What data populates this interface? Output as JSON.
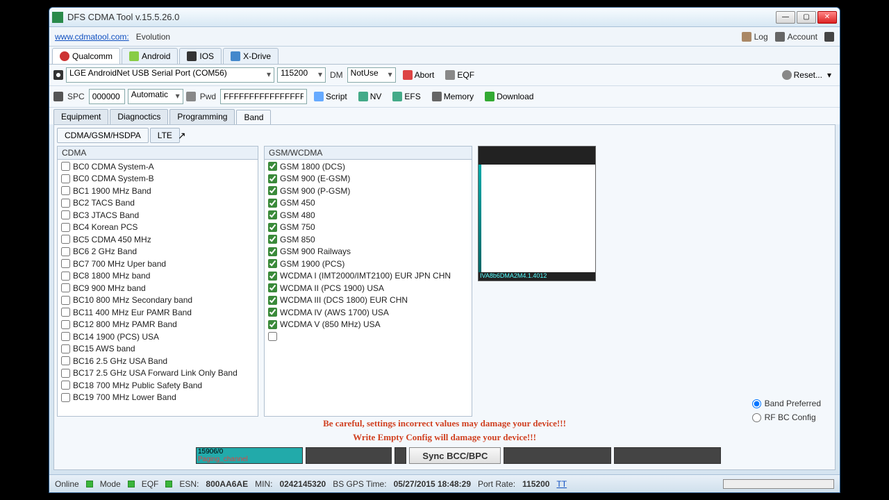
{
  "window": {
    "title": "DFS CDMA Tool v.15.5.26.0"
  },
  "menubar": {
    "link": "www.cdmatool.com:",
    "evolution": "Evolution",
    "log": "Log",
    "account": "Account"
  },
  "platform_tabs": {
    "qualcomm": "Qualcomm",
    "android": "Android",
    "ios": "IOS",
    "xdrive": "X-Drive"
  },
  "toolbar1": {
    "port": "LGE AndroidNet USB Serial Port (COM56)",
    "baud": "115200",
    "dm_label": "DM",
    "dm_value": "NotUse",
    "abort": "Abort",
    "eqf": "EQF",
    "reset": "Reset..."
  },
  "toolbar2": {
    "spc_label": "SPC",
    "spc_value": "000000",
    "spc_mode": "Automatic",
    "pwd_label": "Pwd",
    "pwd_value": "FFFFFFFFFFFFFFFF",
    "script": "Script",
    "nv": "NV",
    "efs": "EFS",
    "memory": "Memory",
    "download": "Download"
  },
  "main_tabs": {
    "equipment": "Equipment",
    "diagnostics": "Diagnoctics",
    "programming": "Programming",
    "band": "Band"
  },
  "sub_tabs": {
    "cdma": "CDMA/GSM/HSDPA",
    "lte": "LTE"
  },
  "cdma_header": "CDMA",
  "cdma_bands": [
    "BC0 CDMA System-A",
    "BC0 CDMA System-B",
    "BC1 1900 MHz Band",
    "BC2 TACS Band",
    "BC3 JTACS Band",
    "BC4 Korean PCS",
    "BC5 CDMA 450 MHz",
    "BC6 2 GHz Band",
    "BC7 700 MHz Uper band",
    "BC8 1800 MHz band",
    "BC9 900 MHz band",
    "BC10 800 MHz Secondary band",
    "BC11 400 MHz Eur PAMR Band",
    "BC12 800 MHz PAMR Band",
    "BC14 1900 (PCS) USA",
    "BC15 AWS band",
    "BC16 2.5 GHz USA Band",
    "BC17 2.5 GHz USA Forward Link Only Band",
    "BC18 700 MHz Public Safety Band",
    "BC19 700 MHz Lower Band"
  ],
  "gsm_header": "GSM/WCDMA",
  "gsm_bands": [
    "GSM 1800 (DCS)",
    "GSM 900 (E-GSM)",
    "GSM 900 (P-GSM)",
    "GSM 450",
    "GSM 480",
    "GSM 750",
    "GSM 850",
    "GSM 900 Railways",
    "GSM 1900 (PCS)",
    "WCDMA I (IMT2000/IMT2100) EUR JPN CHN",
    "WCDMA II (PCS 1900) USA",
    "WCDMA III (DCS 1800) EUR CHN",
    "WCDMA IV (AWS 1700) USA",
    "WCDMA V (850 MHz) USA"
  ],
  "preview_bottom": "IVA8b6DMA2M4.1.4012",
  "warning1": "Be careful, settings incorrect values may damage your device!!!",
  "warning2": "Write Empty Config will damage your device!!!",
  "bottom": {
    "box1a": "15906/0",
    "box1b": "Paging_channel",
    "sync": "Sync BCC/BPC"
  },
  "radios": {
    "preferred": "Band Preferred",
    "rfbc": "RF BC Config"
  },
  "status": {
    "online": "Online",
    "mode": "Mode",
    "eqf": "EQF",
    "esn_label": "ESN:",
    "esn": "800AA6AE",
    "min_label": "MIN:",
    "min": "0242145320",
    "gps_label": "BS GPS Time:",
    "gps": "05/27/2015 18:48:29",
    "rate_label": "Port Rate:",
    "rate": "115200",
    "tt": "TT"
  }
}
